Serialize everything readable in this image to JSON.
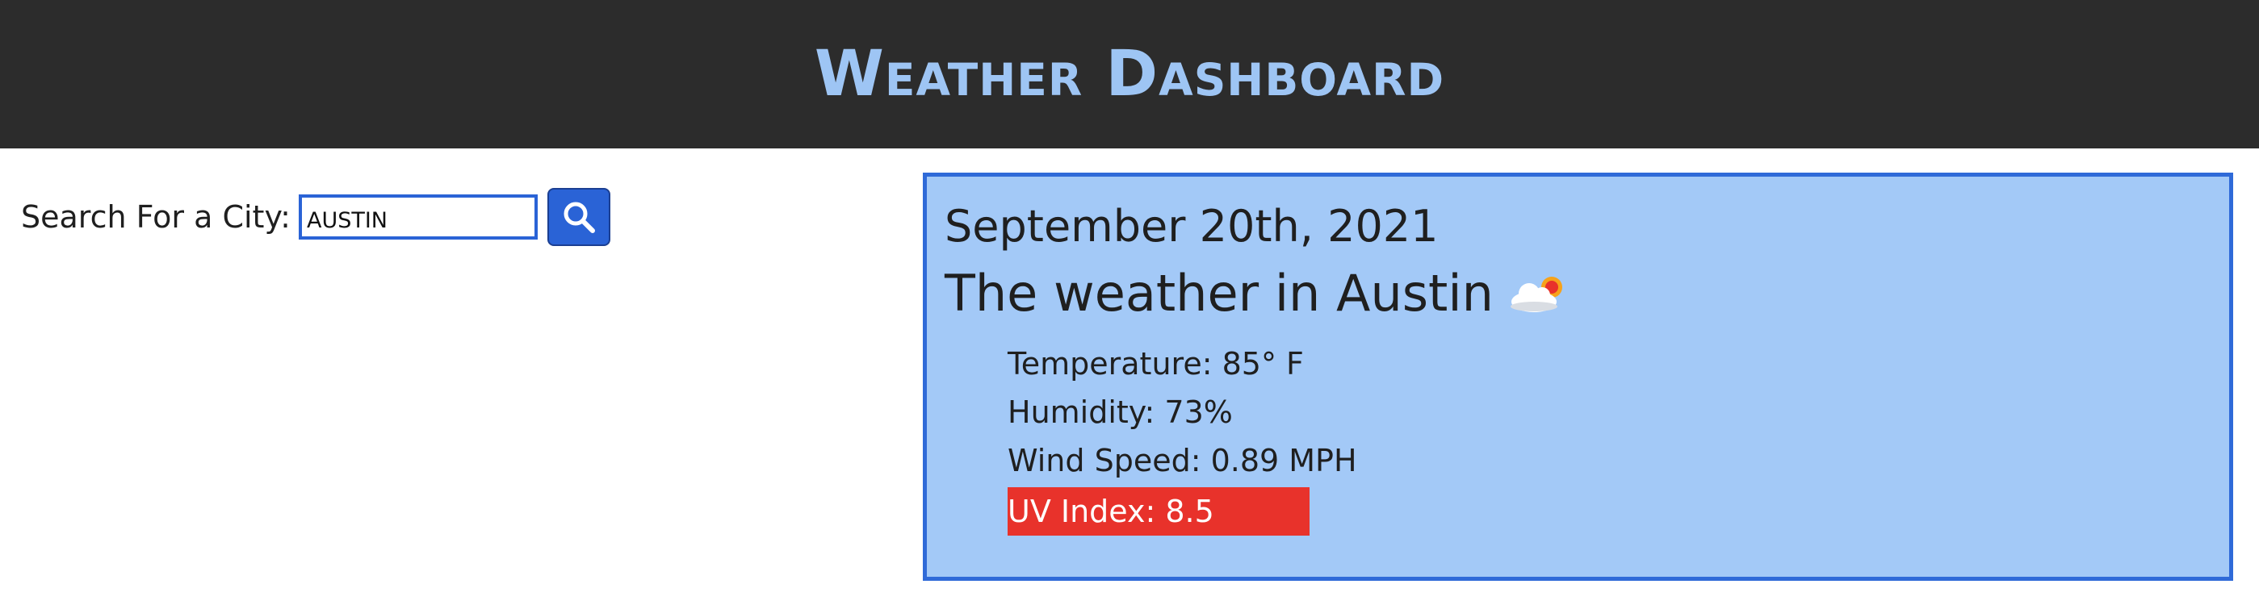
{
  "header": {
    "title": "Weather Dashboard"
  },
  "search": {
    "label": "Search For a City:",
    "value": "AUSTIN",
    "button_icon": "search-icon",
    "accent_color": "#2a63d6"
  },
  "current": {
    "date": "September 20th, 2021",
    "title": "The weather in Austin",
    "icon": "partly-cloudy-sun-icon",
    "temperature": "Temperature: 85° F",
    "humidity": "Humidity: 73%",
    "wind_speed": "Wind Speed: 0.89 MPH",
    "uv_index": "UV Index: 8.5",
    "uv_color": "#e8322b",
    "card_color": "#a3c9f7"
  }
}
